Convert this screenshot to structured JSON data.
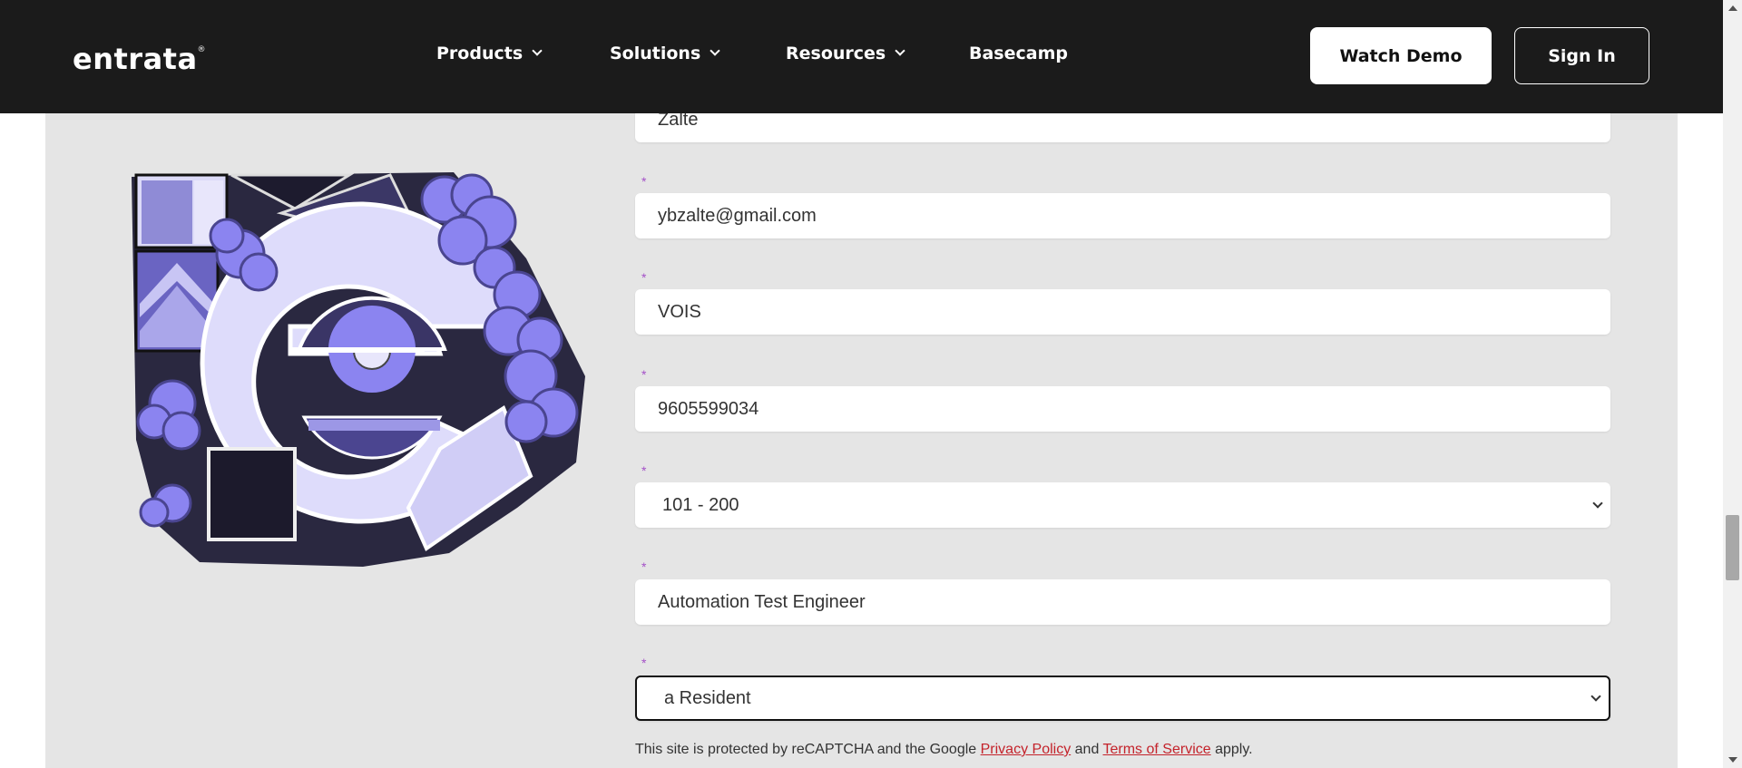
{
  "header": {
    "logo_text": "entrata",
    "logo_mark": "®",
    "nav": [
      {
        "label": "Products",
        "has_dropdown": true
      },
      {
        "label": "Solutions",
        "has_dropdown": true
      },
      {
        "label": "Resources",
        "has_dropdown": true
      },
      {
        "label": "Basecamp",
        "has_dropdown": false
      }
    ],
    "watch_demo_label": "Watch Demo",
    "sign_in_label": "Sign In"
  },
  "form": {
    "required_marker": "*",
    "last_name_value": "Zalte",
    "email_value": "ybzalte@gmail.com",
    "company_value": "VOIS",
    "phone_value": "9605599034",
    "unit_count_selected": "101 - 200",
    "job_title_value": "Automation Test Engineer",
    "i_am_selected": "a Resident"
  },
  "recaptcha": {
    "prefix": "This site is protected by reCAPTCHA and the Google ",
    "privacy_link": "Privacy Policy",
    "and": " and ",
    "terms_link": "Terms of Service",
    "suffix": " apply."
  },
  "colors": {
    "header_bg": "#1b1b1b",
    "panel_bg": "#e5e5e5",
    "required_marker": "#a450c8",
    "link": "#c4232b",
    "illustration_accent": "#8b84f0"
  }
}
